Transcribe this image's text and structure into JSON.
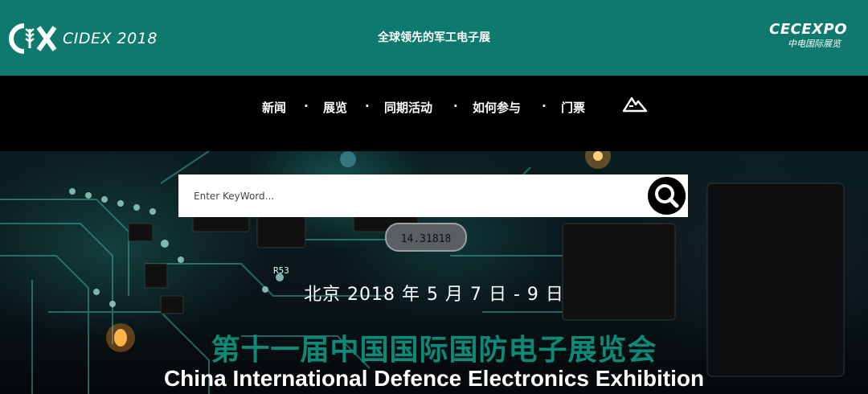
{
  "header": {
    "logo_left_text": "CIDEX 2018",
    "tagline": "全球领先的军工电子展",
    "logo_right_line1": "CECEXPO",
    "logo_right_line2": "中电国际展览"
  },
  "nav": {
    "items": [
      {
        "label": "新闻"
      },
      {
        "label": "展览"
      },
      {
        "label": "同期活动"
      },
      {
        "label": "如何参与"
      },
      {
        "label": "门票"
      }
    ],
    "separator": "·",
    "extra_icon": "mountain-icon"
  },
  "search": {
    "placeholder": "Enter KeyWord...",
    "button_icon": "search-icon"
  },
  "hero": {
    "date": "北京 2018 年 5 月 7 日 - 9 日",
    "title_cn": "第十一届中国国际国防电子展览会",
    "title_en": "China International Defence Electronics Exhibition",
    "chip_labels": [
      "14.31818",
      "R53"
    ]
  },
  "colors": {
    "topbar": "#0e7a6e",
    "title_cn": "#0b8a78",
    "navbar": "#000000"
  }
}
